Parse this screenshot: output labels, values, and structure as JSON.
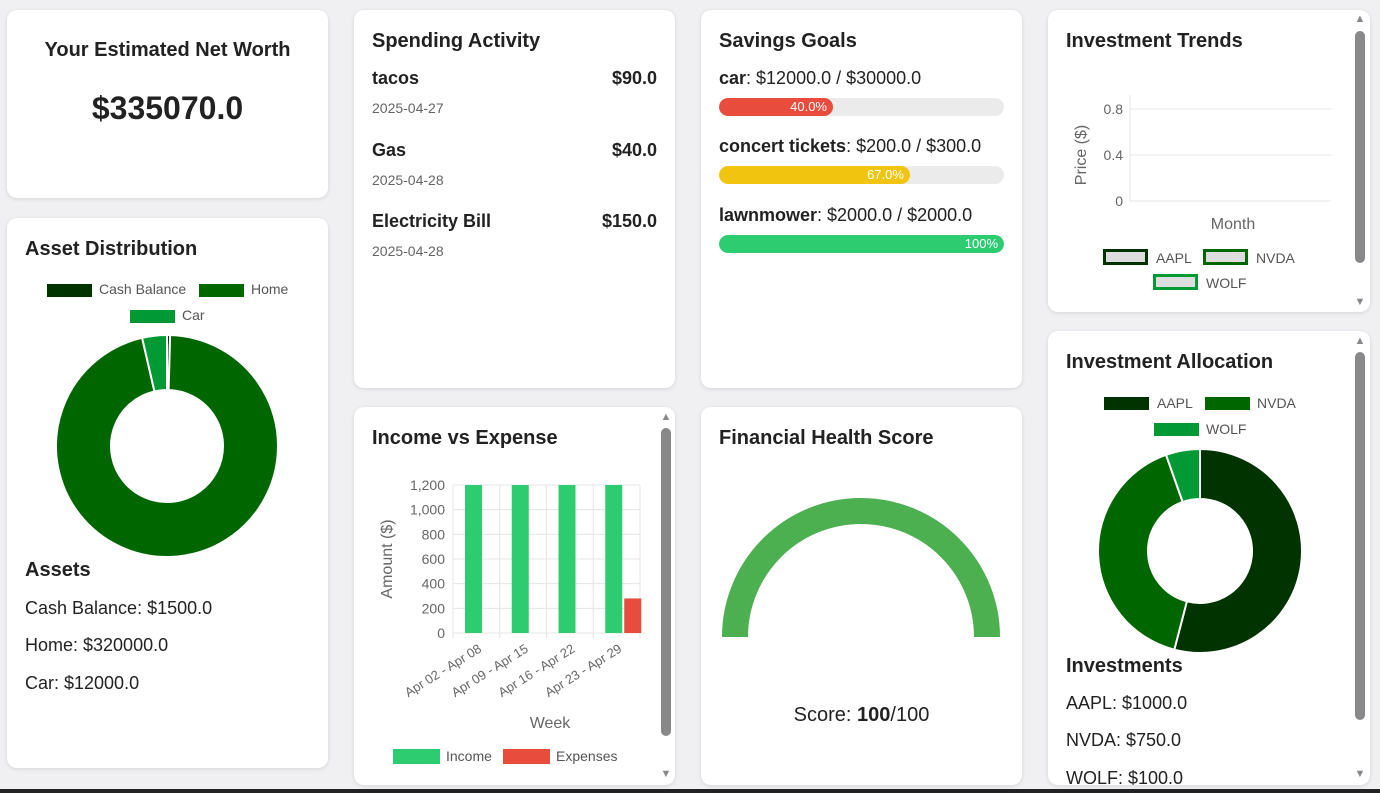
{
  "net_worth": {
    "title": "Your Estimated Net Worth",
    "value": "$335070.0"
  },
  "spending": {
    "title": "Spending Activity",
    "items": [
      {
        "name": "tacos",
        "amount": "$90.0",
        "date": "2025-04-27"
      },
      {
        "name": "Gas",
        "amount": "$40.0",
        "date": "2025-04-28"
      },
      {
        "name": "Electricity Bill",
        "amount": "$150.0",
        "date": "2025-04-28"
      }
    ]
  },
  "savings": {
    "title": "Savings Goals",
    "goals": [
      {
        "name": "car",
        "progress_text": ": $12000.0 / $30000.0",
        "percent_label": "40.0%",
        "progress": 0.4,
        "color": "#e74c3c"
      },
      {
        "name": "concert tickets",
        "progress_text": ": $200.0 / $300.0",
        "percent_label": "67.0%",
        "progress": 0.67,
        "color": "#f1c40f"
      },
      {
        "name": "lawnmower",
        "progress_text": ": $2000.0 / $2000.0",
        "percent_label": "100%",
        "progress": 1.0,
        "color": "#2ecc71"
      }
    ]
  },
  "investment_trends": {
    "title": "Investment Trends",
    "legend": [
      "AAPL",
      "NVDA",
      "WOLF"
    ],
    "chart_data": {
      "type": "line",
      "xlabel": "Month",
      "ylabel": "Price ($)",
      "y_ticks": [
        "0.8",
        "0.4",
        "0"
      ],
      "series": [
        {
          "name": "AAPL",
          "values": []
        },
        {
          "name": "NVDA",
          "values": []
        },
        {
          "name": "WOLF",
          "values": []
        }
      ]
    }
  },
  "asset_distribution": {
    "title": "Asset Distribution",
    "legend": [
      "Cash Balance",
      "Home",
      "Car"
    ],
    "colors": [
      "#003300",
      "#006600",
      "#009933"
    ],
    "chart_data": {
      "type": "pie",
      "categories": [
        "Cash Balance",
        "Home",
        "Car"
      ],
      "values": [
        1500,
        320000,
        12000
      ]
    },
    "assets_heading": "Assets",
    "assets": [
      "Cash Balance: $1500.0",
      "Home: $320000.0",
      "Car: $12000.0"
    ]
  },
  "income_expense": {
    "title": "Income vs Expense",
    "legend": [
      "Income",
      "Expenses"
    ],
    "colors": {
      "income": "#2ecc71",
      "expenses": "#e74c3c"
    },
    "chart_data": {
      "type": "bar",
      "categories": [
        "Apr 02 - Apr 08",
        "Apr 09 - Apr 15",
        "Apr 16 - Apr 22",
        "Apr 23 - Apr 29"
      ],
      "series": [
        {
          "name": "Income",
          "values": [
            1200,
            1200,
            1200,
            1200
          ]
        },
        {
          "name": "Expenses",
          "values": [
            0,
            0,
            0,
            280
          ]
        }
      ],
      "xlabel": "Week",
      "ylabel": "Amount ($)",
      "y_ticks": [
        "1,200",
        "1,000",
        "800",
        "600",
        "400",
        "200",
        "0"
      ],
      "ylim": [
        0,
        1200
      ]
    }
  },
  "health": {
    "title": "Financial Health Score",
    "score_label": "Score: ",
    "score": "100",
    "score_max": "/100",
    "progress": 1.0,
    "color": "#4caf50"
  },
  "investment_allocation": {
    "title": "Investment Allocation",
    "legend": [
      "AAPL",
      "NVDA",
      "WOLF"
    ],
    "colors": [
      "#003300",
      "#006600",
      "#009933"
    ],
    "chart_data": {
      "type": "pie",
      "categories": [
        "AAPL",
        "NVDA",
        "WOLF"
      ],
      "values": [
        1000,
        750,
        100
      ]
    },
    "investments_heading": "Investments",
    "investments": [
      "AAPL: $1000.0",
      "NVDA: $750.0",
      "WOLF: $100.0"
    ]
  },
  "icons": {
    "scroll_up": "triangle-up",
    "scroll_down": "triangle-down"
  }
}
